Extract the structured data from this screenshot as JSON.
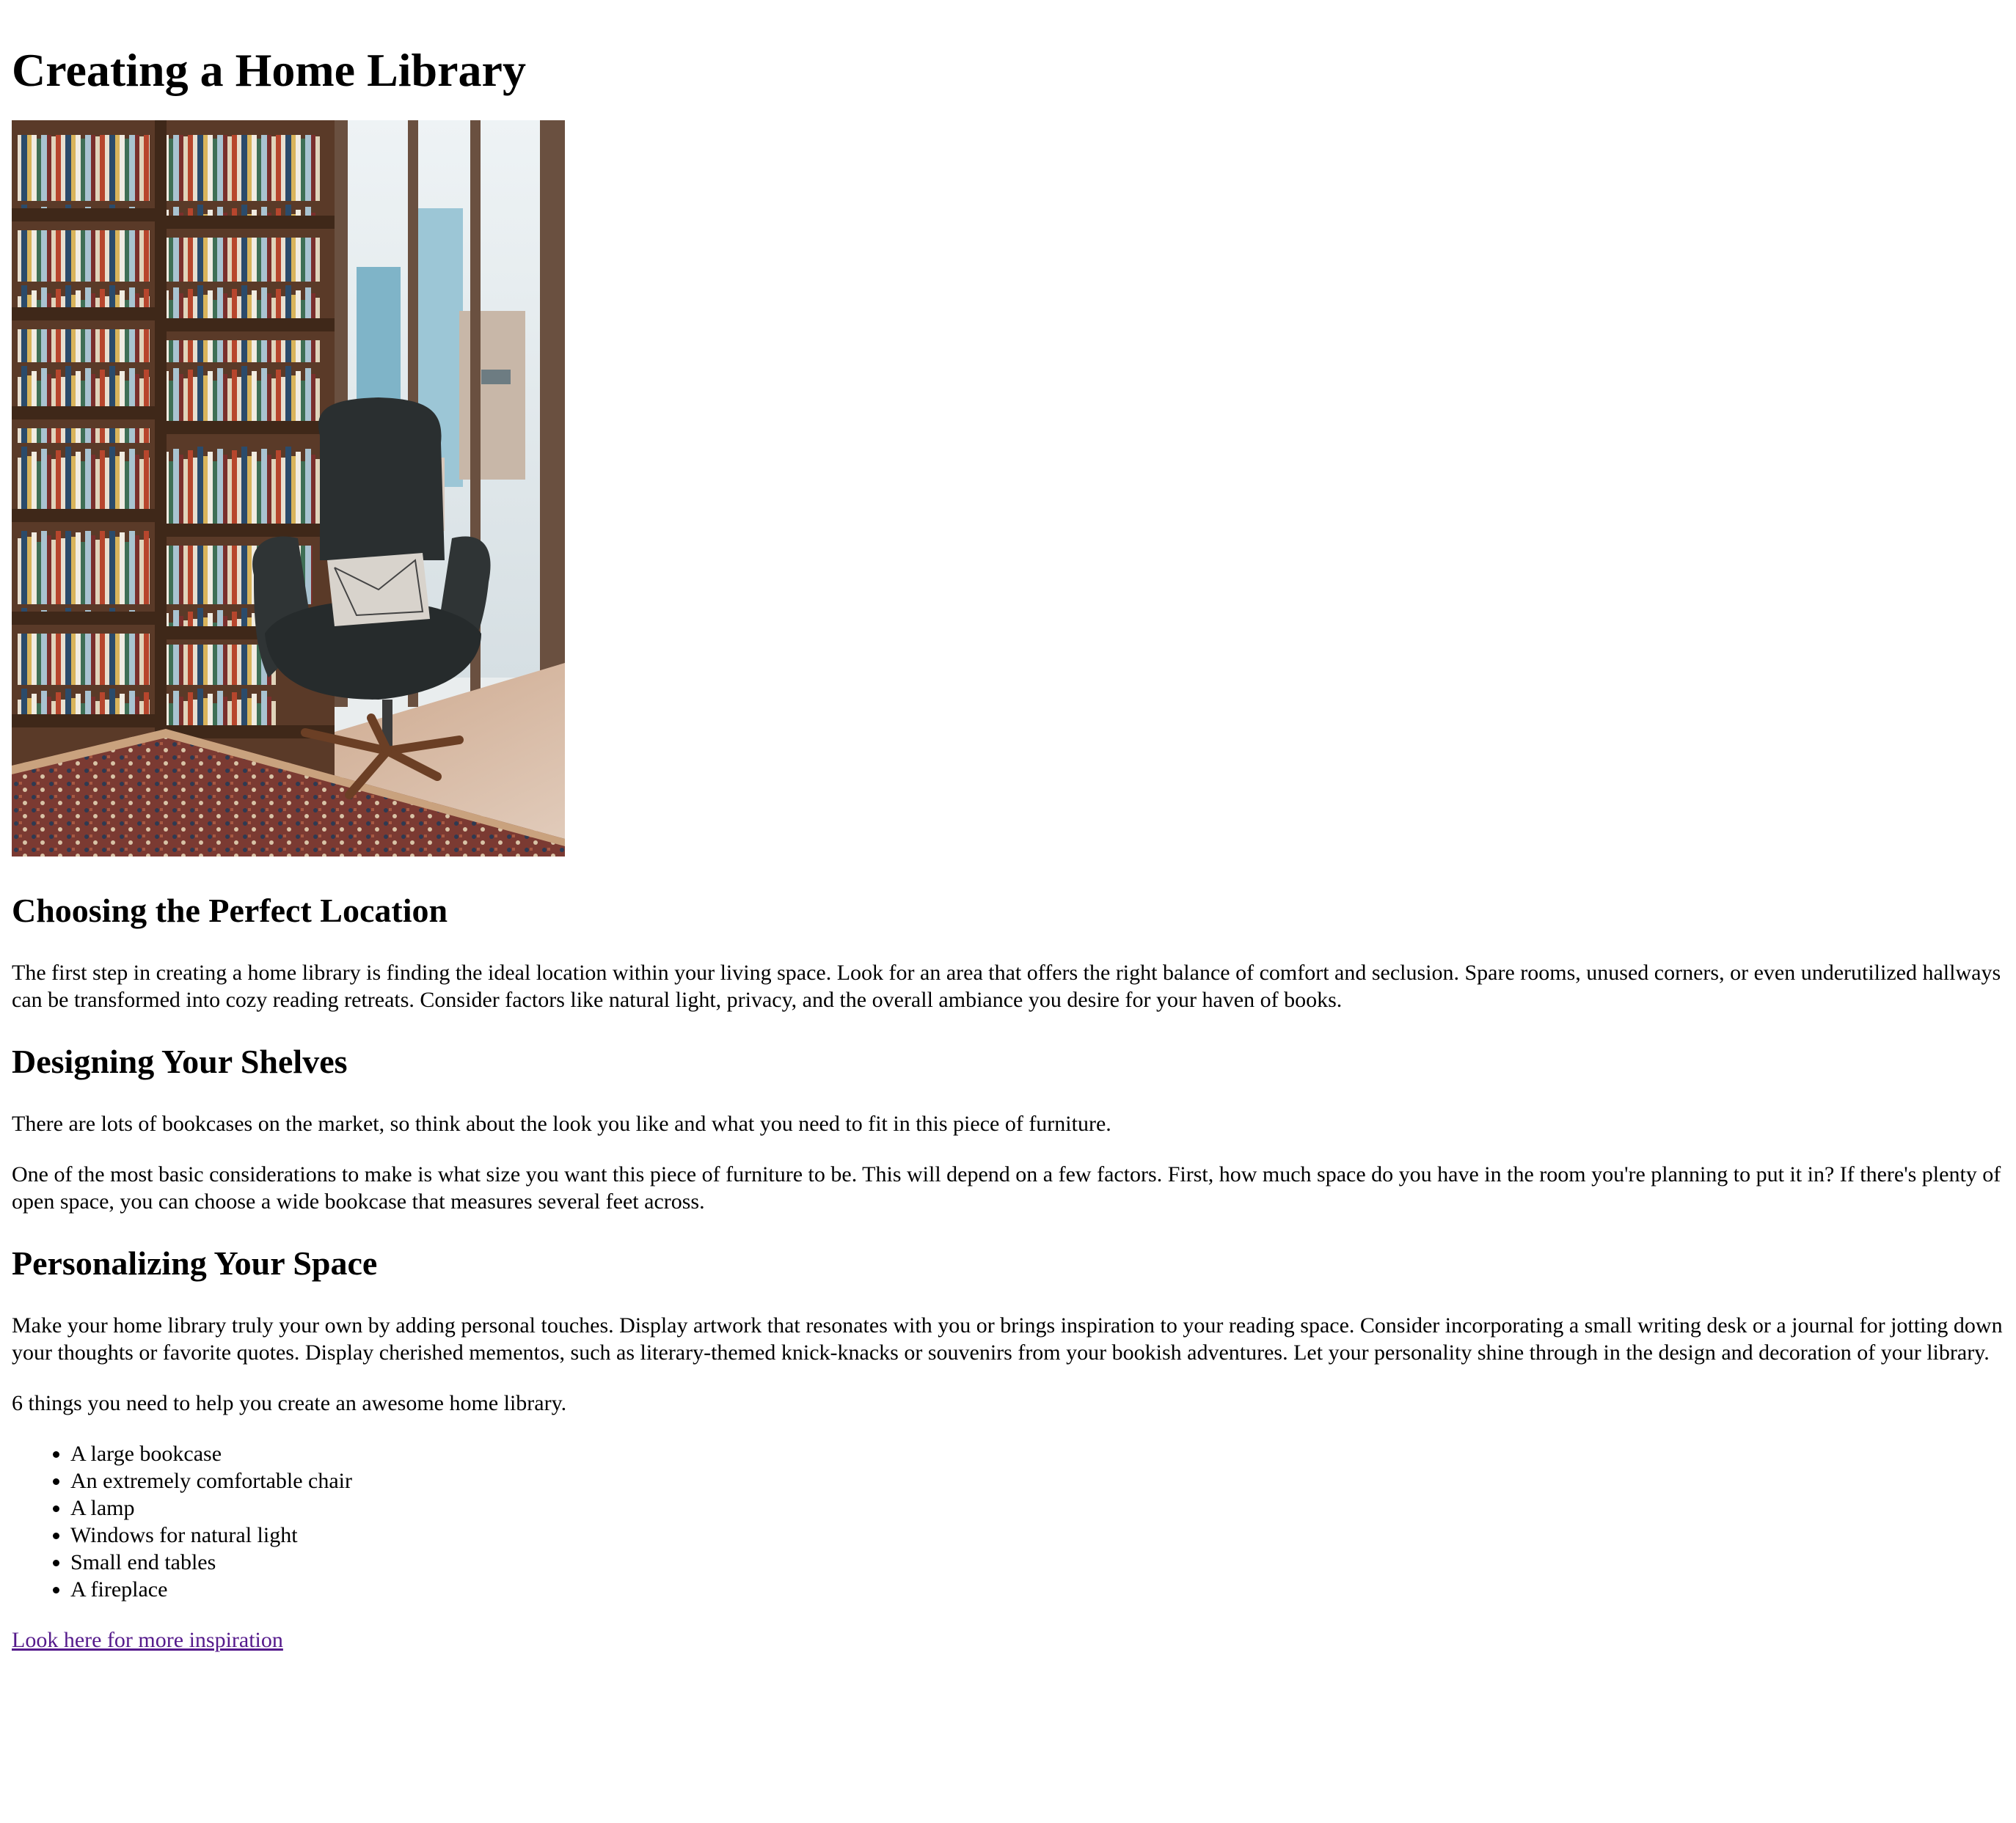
{
  "article": {
    "title": "Creating a Home Library",
    "hero_image": {
      "alt": "",
      "icon": "library-reading-chair-photo",
      "colors": {
        "wood": "#5a3a28",
        "window": "#dfe9ee",
        "chair": "#2a2f30",
        "rug": "#7b3a32"
      }
    },
    "sections": [
      {
        "heading": "Choosing the Perfect Location",
        "paragraphs": [
          "The first step in creating a home library is finding the ideal location within your living space. Look for an area that offers the right balance of comfort and seclusion. Spare rooms, unused corners, or even underutilized hallways can be transformed into cozy reading retreats. Consider factors like natural light, privacy, and the overall ambiance you desire for your haven of books."
        ]
      },
      {
        "heading": "Designing Your Shelves",
        "paragraphs": [
          "There are lots of bookcases on the market, so think about the look you like and what you need to fit in this piece of furniture.",
          "One of the most basic considerations to make is what size you want this piece of furniture to be. This will depend on a few factors. First, how much space do you have in the room you're planning to put it in? If there's plenty of open space, you can choose a wide bookcase that measures several feet across."
        ]
      },
      {
        "heading": "Personalizing Your Space",
        "paragraphs": [
          "Make your home library truly your own by adding personal touches. Display artwork that resonates with you or brings inspiration to your reading space. Consider incorporating a small writing desk or a journal for jotting down your thoughts or favorite quotes. Display cherished mementos, such as literary-themed knick-knacks or souvenirs from your bookish adventures. Let your personality shine through in the design and decoration of your library.",
          "6 things you need to help you create an awesome home library."
        ]
      }
    ],
    "list_items": [
      "A large bookcase",
      "An extremely comfortable chair",
      "A lamp",
      "Windows for natural light",
      "Small end tables",
      "A fireplace"
    ],
    "link": {
      "label": "Look here for more inspiration",
      "color": "#551a8b"
    }
  }
}
